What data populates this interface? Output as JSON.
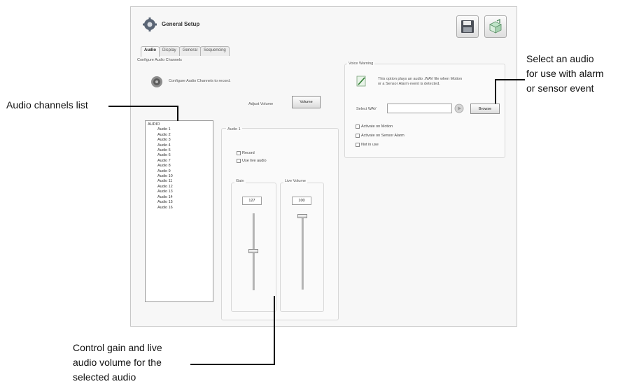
{
  "window": {
    "title": "General Setup",
    "toolbar": {
      "save_icon": "floppy-disk-icon",
      "export_icon": "box-export-icon"
    }
  },
  "tabs": [
    {
      "label": "Audio",
      "active": true
    },
    {
      "label": "Display",
      "active": false
    },
    {
      "label": "General",
      "active": false
    },
    {
      "label": "Sequencing",
      "active": false
    }
  ],
  "configure": {
    "group_label": "Configure Audio Channels",
    "description": "Configure Audio Channels to record.",
    "adjust_label": "Adjust Volume",
    "volume_button": "Volume"
  },
  "channel_list": {
    "header": "AUDIO",
    "items": [
      "Audio 1",
      "Audio 2",
      "Audio 3",
      "Audio 4",
      "Audio 5",
      "Audio 6",
      "Audio 7",
      "Audio 8",
      "Audio 9",
      "Audio 10",
      "Audio 11",
      "Audio 12",
      "Audio 13",
      "Audio 14",
      "Audio 15",
      "Audio 16"
    ]
  },
  "audio_detail": {
    "group_label": "Audio 1",
    "record_label": "Record",
    "use_live_label": "Use live audio",
    "gain_label": "Gain",
    "gain_value": "127",
    "live_volume_label": "Live Volume",
    "live_volume_value": "100"
  },
  "voice_warning": {
    "group_label": "Voice Warning",
    "description_line1": "This option plays an audio .WAV file when Motion",
    "description_line2": "or a Sensor Alarm event is detected.",
    "select_label": "Select WAV",
    "select_value": "",
    "browse_button": "Browse",
    "options": [
      {
        "label": "Activate on Motion",
        "checked": false
      },
      {
        "label": "Activate on Sensor Alarm",
        "checked": false
      },
      {
        "label": "Not in use",
        "checked": false
      }
    ]
  },
  "annotations": {
    "channels_list": "Audio channels list",
    "select_audio_line1": "Select an audio",
    "select_audio_line2": "for use with alarm",
    "select_audio_line3": "or sensor event",
    "gain_control_line1": "Control gain and live",
    "gain_control_line2": "audio volume for the",
    "gain_control_line3": "selected audio"
  }
}
